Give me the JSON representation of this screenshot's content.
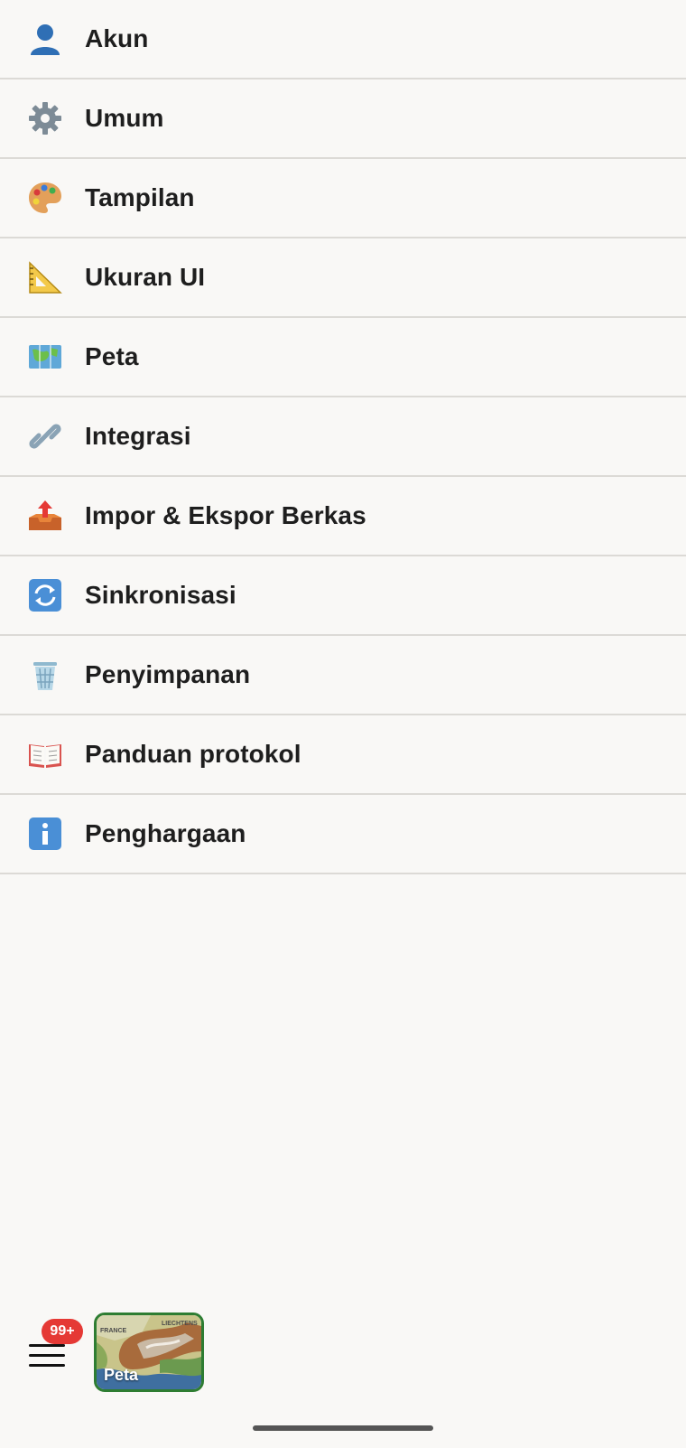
{
  "menu": {
    "items": [
      {
        "label": "Akun",
        "icon": "user-icon"
      },
      {
        "label": "Umum",
        "icon": "gear-icon"
      },
      {
        "label": "Tampilan",
        "icon": "palette-icon"
      },
      {
        "label": "Ukuran UI",
        "icon": "ruler-icon"
      },
      {
        "label": "Peta",
        "icon": "map-icon"
      },
      {
        "label": "Integrasi",
        "icon": "link-icon"
      },
      {
        "label": "Impor & Ekspor Berkas",
        "icon": "outbox-tray-icon"
      },
      {
        "label": "Sinkronisasi",
        "icon": "sync-icon"
      },
      {
        "label": "Penyimpanan",
        "icon": "trash-icon"
      },
      {
        "label": "Panduan protokol",
        "icon": "book-icon"
      },
      {
        "label": "Penghargaan",
        "icon": "info-icon"
      }
    ]
  },
  "bottom_bar": {
    "badge_count": "99+",
    "map_thumb_label": "Peta",
    "map_small_labels": [
      "FRANCE",
      "LIECHTENS"
    ]
  },
  "colors": {
    "background": "#f9f8f6",
    "divider": "#dcdad6",
    "badge": "#e53935",
    "thumb_border": "#2e7d32"
  }
}
